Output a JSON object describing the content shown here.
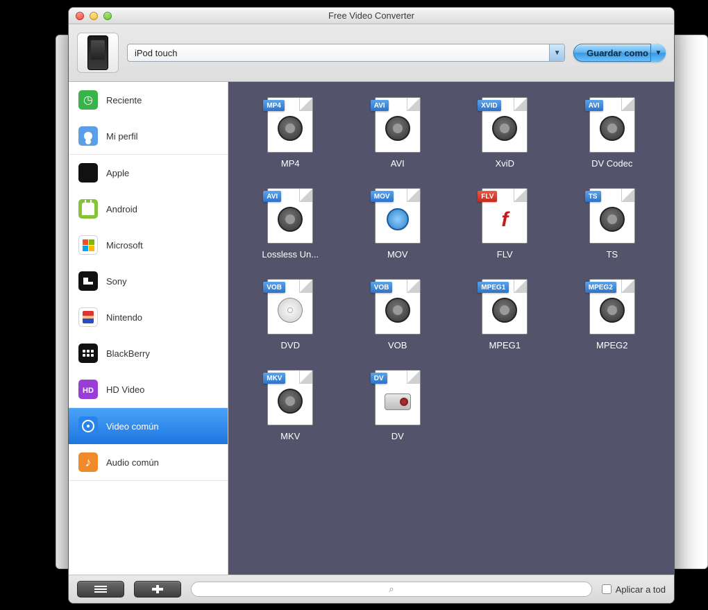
{
  "window": {
    "title": "Free Video Converter"
  },
  "toolbar": {
    "preset_selected": "iPod touch",
    "save_as": "Guardar como"
  },
  "sidebar": {
    "groups": [
      {
        "items": [
          {
            "id": "recent",
            "label": "Reciente",
            "icon": "clock-icon",
            "iclass": "i-recent"
          },
          {
            "id": "profile",
            "label": "Mi perfil",
            "icon": "user-icon",
            "iclass": "i-profile"
          }
        ]
      },
      {
        "items": [
          {
            "id": "apple",
            "label": "Apple",
            "icon": "apple-icon",
            "iclass": "i-apple"
          },
          {
            "id": "android",
            "label": "Android",
            "icon": "android-icon",
            "iclass": "i-android"
          },
          {
            "id": "ms",
            "label": "Microsoft",
            "icon": "windows-icon",
            "iclass": "i-ms"
          },
          {
            "id": "sony",
            "label": "Sony",
            "icon": "playstation-icon",
            "iclass": "i-sony"
          },
          {
            "id": "nintendo",
            "label": "Nintendo",
            "icon": "mario-icon",
            "iclass": "i-nintendo"
          },
          {
            "id": "bb",
            "label": "BlackBerry",
            "icon": "blackberry-icon",
            "iclass": "i-bb"
          },
          {
            "id": "hd",
            "label": "HD Video",
            "icon": "hd-icon",
            "iclass": "i-hd"
          }
        ]
      },
      {
        "items": [
          {
            "id": "video",
            "label": "Video común",
            "icon": "film-reel-icon",
            "iclass": "i-video",
            "selected": true
          },
          {
            "id": "audio",
            "label": "Audio común",
            "icon": "music-note-icon",
            "iclass": "i-audio"
          }
        ]
      }
    ]
  },
  "formats": [
    {
      "label": "MP4",
      "tag": "MP4",
      "tagColor": "blue",
      "glyph": "reel"
    },
    {
      "label": "AVI",
      "tag": "AVI",
      "tagColor": "blue",
      "glyph": "reel"
    },
    {
      "label": "XviD",
      "tag": "XVID",
      "tagColor": "blue",
      "glyph": "reel"
    },
    {
      "label": "DV Codec",
      "tag": "AVI",
      "tagColor": "blue",
      "glyph": "reel"
    },
    {
      "label": "Lossless Un...",
      "tag": "AVI",
      "tagColor": "blue",
      "glyph": "reel"
    },
    {
      "label": "MOV",
      "tag": "MOV",
      "tagColor": "blue",
      "glyph": "qt"
    },
    {
      "label": "FLV",
      "tag": "FLV",
      "tagColor": "red",
      "glyph": "flash"
    },
    {
      "label": "TS",
      "tag": "TS",
      "tagColor": "blue",
      "glyph": "reel"
    },
    {
      "label": "DVD",
      "tag": "VOB",
      "tagColor": "blue",
      "glyph": "disc"
    },
    {
      "label": "VOB",
      "tag": "VOB",
      "tagColor": "blue",
      "glyph": "reel"
    },
    {
      "label": "MPEG1",
      "tag": "MPEG1",
      "tagColor": "blue",
      "glyph": "reel"
    },
    {
      "label": "MPEG2",
      "tag": "MPEG2",
      "tagColor": "blue",
      "glyph": "reel"
    },
    {
      "label": "MKV",
      "tag": "MKV",
      "tagColor": "blue",
      "glyph": "reel"
    },
    {
      "label": "DV",
      "tag": "DV",
      "tagColor": "blue",
      "glyph": "cam"
    }
  ],
  "footer": {
    "apply_all": "Aplicar a tod"
  }
}
